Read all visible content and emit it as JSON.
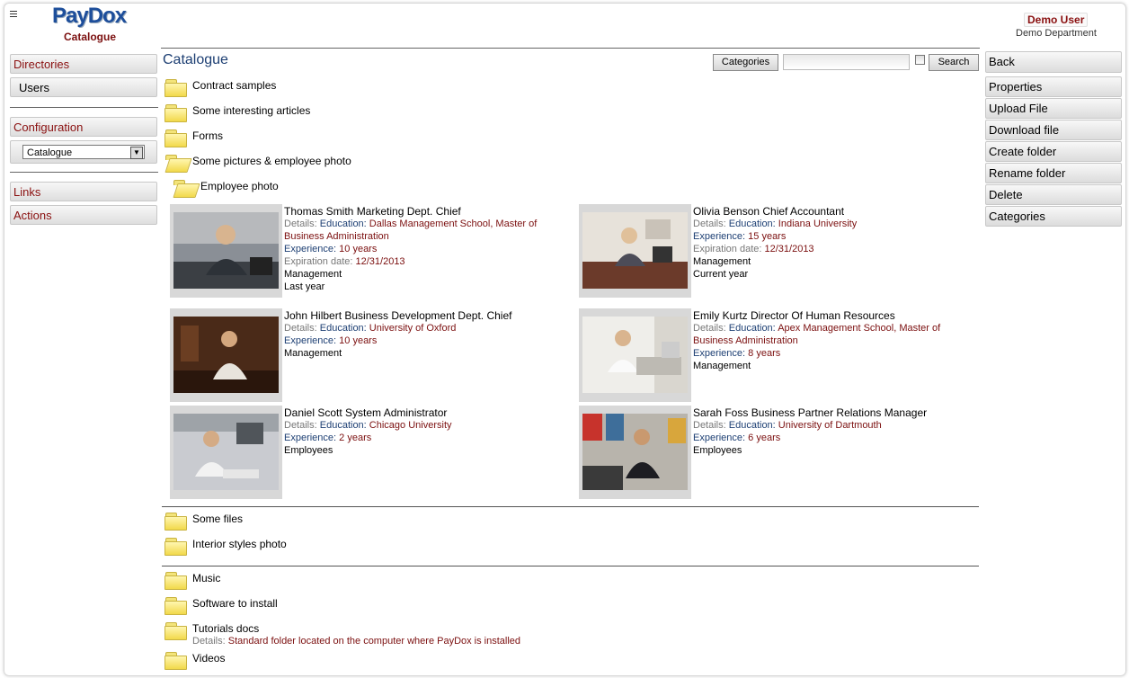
{
  "app": {
    "logo": "PayDox",
    "section": "Catalogue"
  },
  "user": {
    "name": "Demo User",
    "department": "Demo Department"
  },
  "left_nav": {
    "directories": "Directories",
    "users": "Users",
    "configuration": "Configuration",
    "catalogue_select": "Catalogue",
    "links": "Links",
    "actions": "Actions"
  },
  "main": {
    "title": "Catalogue",
    "categories_button": "Categories",
    "search_value": "",
    "search_button": "Search",
    "folders_top": [
      "Contract samples",
      "Some interesting articles",
      "Forms",
      "Some pictures & employee photo",
      "Employee photo"
    ],
    "employees": [
      {
        "name": "Thomas Smith Marketing Dept. Chief",
        "details_label": "Details:",
        "education_label": "Education:",
        "education": "Dallas Management School, Master of",
        "education2": "Business Administration",
        "experience_label": "Experience:",
        "experience": "10 years",
        "expiration_label": "Expiration date:",
        "expiration": "12/31/2013",
        "extra1": "Management",
        "extra2": "Last year"
      },
      {
        "name": "Olivia Benson Chief Accountant",
        "details_label": "Details:",
        "education_label": "Education:",
        "education": "Indiana University",
        "experience_label": "Experience:",
        "experience": "15 years",
        "expiration_label": "Expiration date:",
        "expiration": "12/31/2013",
        "extra1": "Management",
        "extra2": "Current year"
      },
      {
        "name": "John Hilbert Business Development Dept. Chief",
        "details_label": "Details:",
        "education_label": "Education:",
        "education": "University of Oxford",
        "experience_label": "Experience:",
        "experience": "10 years",
        "extra1": "Management"
      },
      {
        "name": "Emily Kurtz Director Of Human Resources",
        "details_label": "Details:",
        "education_label": "Education:",
        "education": "Apex Management School, Master of",
        "education2": "Business Administration",
        "experience_label": "Experience:",
        "experience": "8 years",
        "extra1": "Management"
      },
      {
        "name": "Daniel Scott System Administrator",
        "details_label": "Details:",
        "education_label": "Education:",
        "education": "Chicago University",
        "experience_label": "Experience:",
        "experience": "2 years",
        "extra1": "Employees"
      },
      {
        "name": "Sarah Foss Business Partner Relations Manager",
        "details_label": "Details:",
        "education_label": "Education:",
        "education": "University of Dartmouth",
        "experience_label": "Experience:",
        "experience": "6 years",
        "extra1": "Employees"
      }
    ],
    "folders_mid": [
      "Some files",
      "Interior styles photo"
    ],
    "folders_bottom": [
      "Music",
      "Software to install",
      "Tutorials docs",
      "Videos"
    ],
    "tutorials_details_label": "Details:",
    "tutorials_details": "Standard folder located on the computer where PayDox is installed"
  },
  "right_actions": [
    "Back",
    "Properties",
    "Upload File",
    "Download file",
    "Create folder",
    "Rename folder",
    "Delete",
    "Categories"
  ],
  "colors": {
    "accent_red": "#7b0f0f",
    "accent_blue": "#1d3f73",
    "folder_yellow": "#f2d94a"
  }
}
